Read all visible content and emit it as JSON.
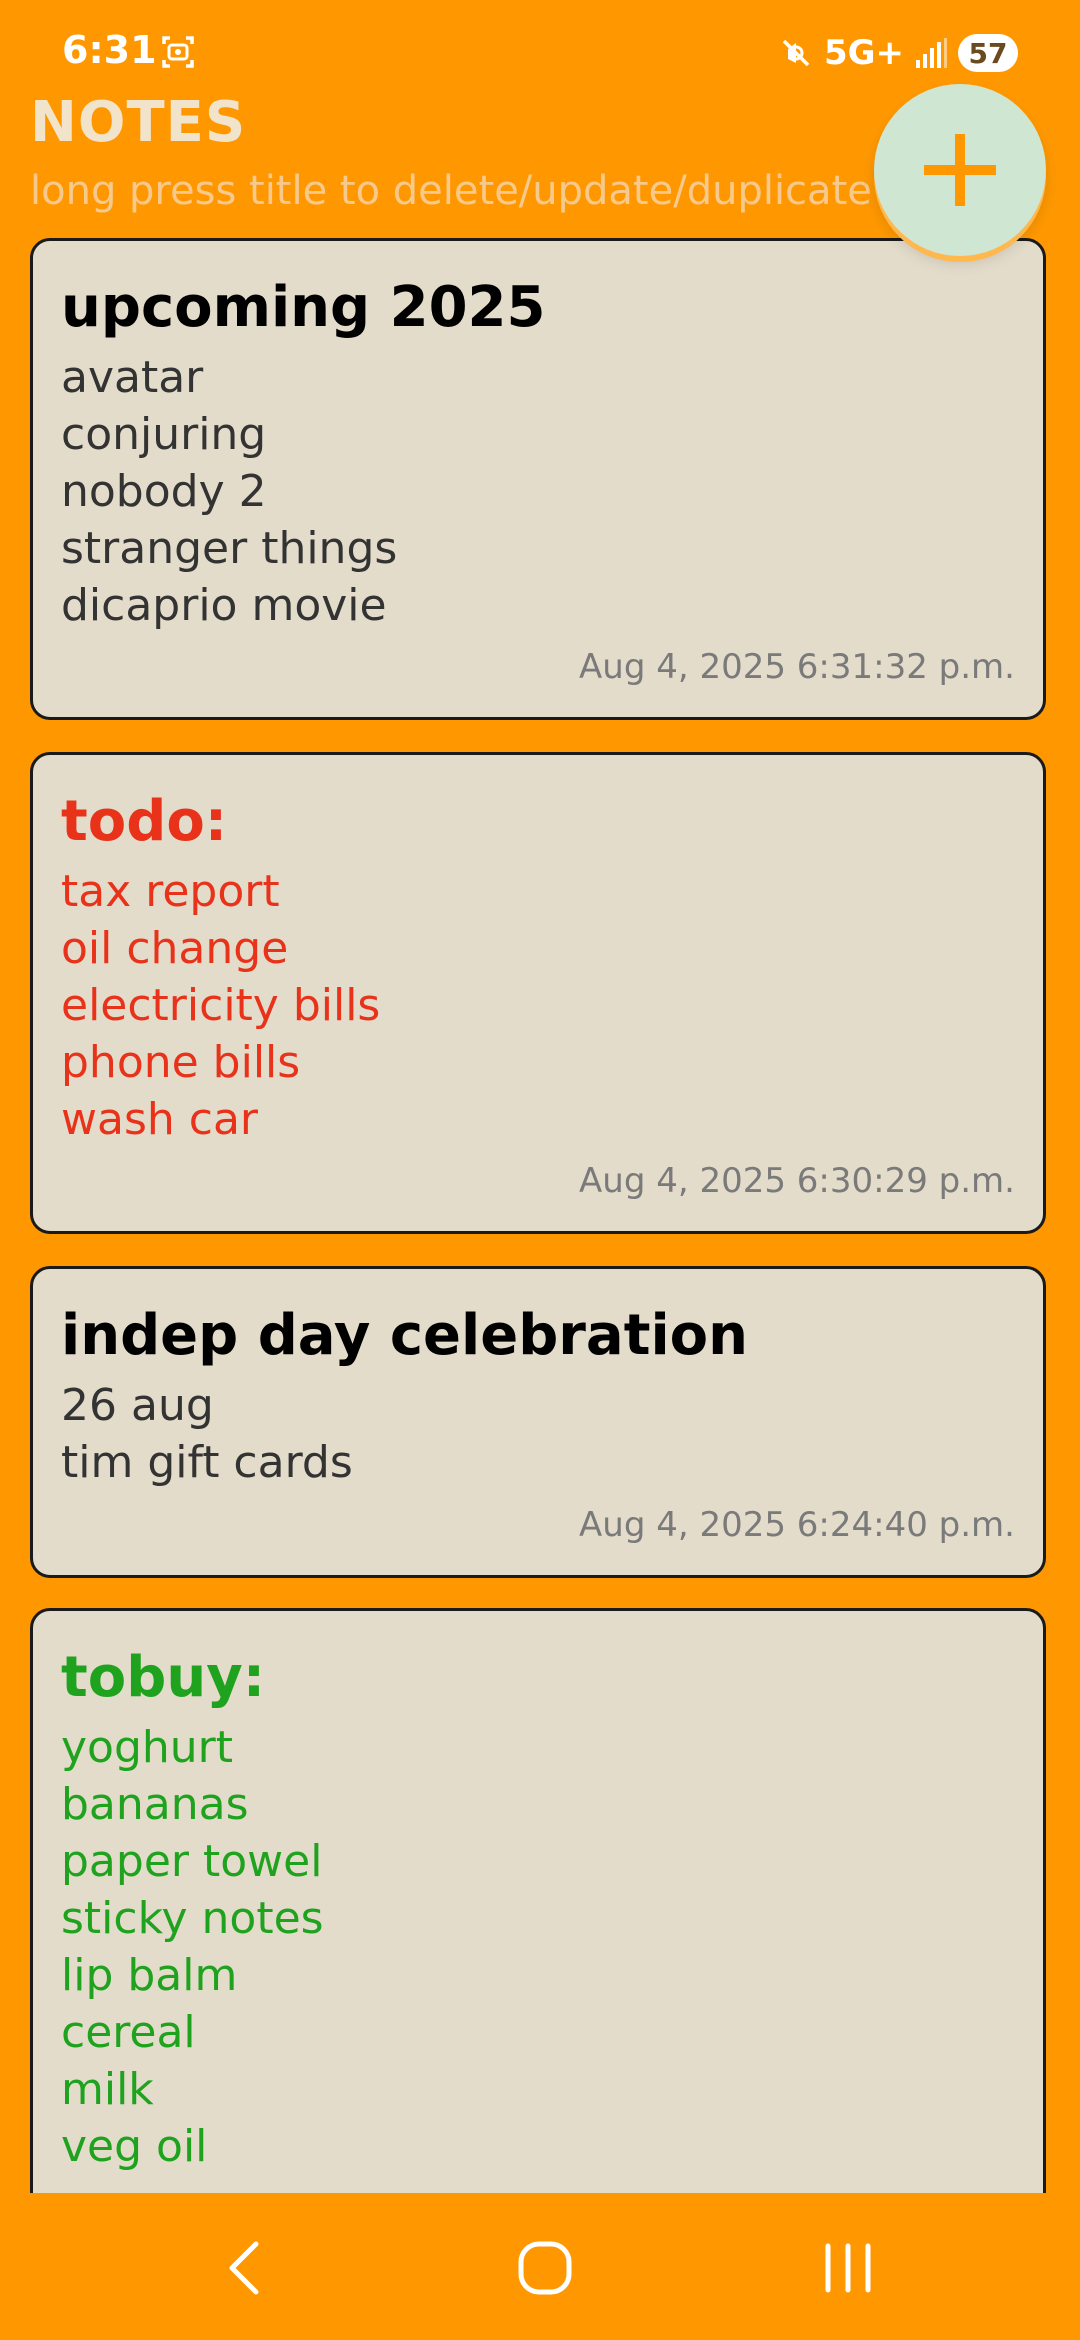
{
  "status": {
    "time": "6:31",
    "network": "5G+",
    "battery": "57"
  },
  "header": {
    "title": "NOTES",
    "hint": "long press title to delete/update/duplicate"
  },
  "colors": {
    "background": "#FF9800",
    "card": "#E4DCCB",
    "fab": "#CFE6D3",
    "accent_orange": "#FF9800",
    "title_black": "#000000",
    "text_dark": "#333333",
    "todo_red": "#E8321A",
    "tobuy_green": "#1FA31F",
    "date_gray": "#7A7A7A"
  },
  "fab": {
    "icon": "plus-icon"
  },
  "notes": [
    {
      "title": "upcoming 2025",
      "lines": [
        "avatar",
        "conjuring",
        "nobody 2",
        "stranger things",
        "dicaprio movie"
      ],
      "date": "Aug 4, 2025 6:31:32 p.m.",
      "title_color": "#000000",
      "text_color": "#333333"
    },
    {
      "title": "todo:",
      "lines": [
        "tax report",
        "oil change",
        "electricity bills",
        "phone bills",
        "wash car"
      ],
      "date": "Aug 4, 2025 6:30:29 p.m.",
      "title_color": "#E8321A",
      "text_color": "#E8321A"
    },
    {
      "title": "indep day celebration",
      "lines": [
        "26 aug",
        "tim gift cards"
      ],
      "date": "Aug 4, 2025 6:24:40 p.m.",
      "title_color": "#000000",
      "text_color": "#333333"
    },
    {
      "title": "tobuy:",
      "lines": [
        "yoghurt",
        "bananas",
        "paper towel",
        "sticky notes",
        "lip balm",
        "cereal",
        "milk",
        "veg oil"
      ],
      "date": "",
      "title_color": "#1FA31F",
      "text_color": "#1FA31F"
    }
  ],
  "nav": {
    "back_icon": "back-icon",
    "home_icon": "home-icon",
    "recents_icon": "recents-icon"
  }
}
